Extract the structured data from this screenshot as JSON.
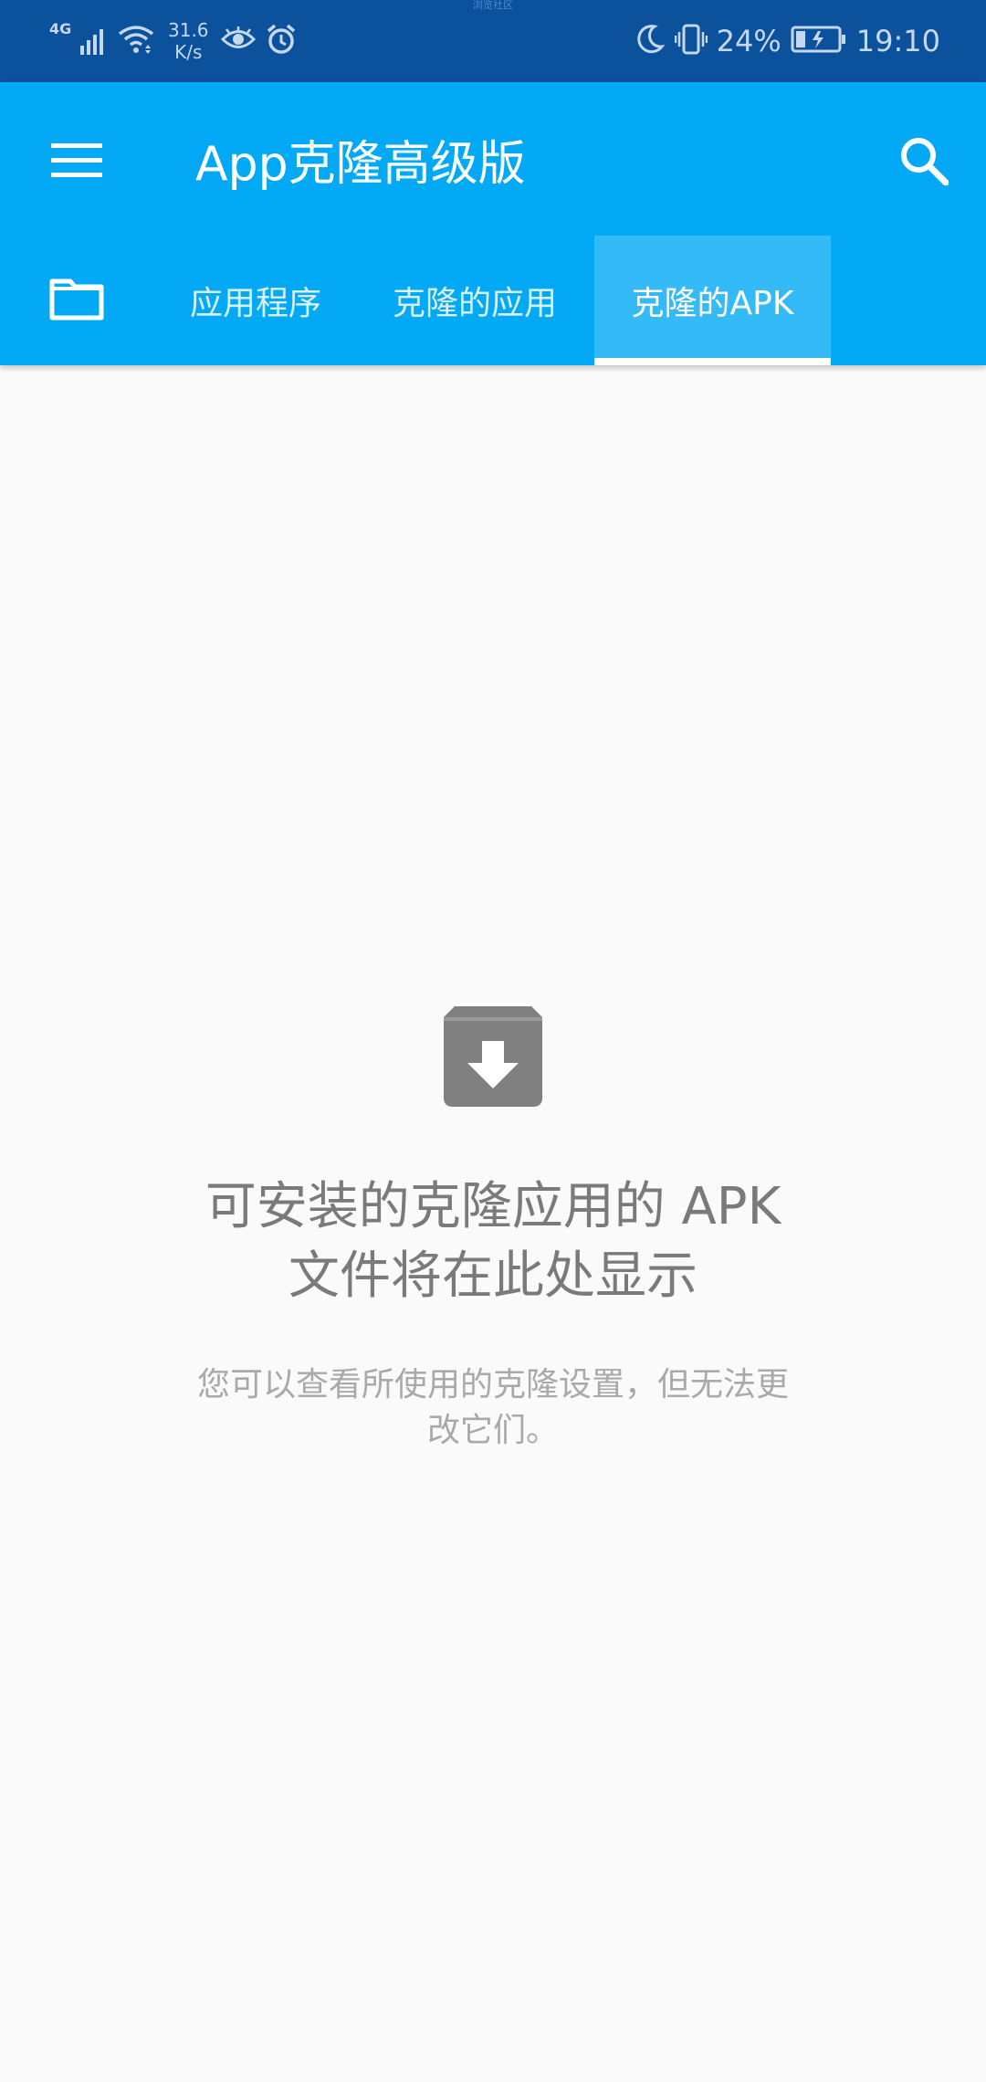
{
  "status_bar": {
    "notch_label": "浏览社区",
    "network_type": "4G",
    "net_speed_value": "31.6",
    "net_speed_unit": "K/s",
    "battery_percent": "24%",
    "time": "19:10",
    "icons_left": [
      "signal-icon",
      "wifi-icon",
      "eye-icon",
      "alarm-icon"
    ],
    "icons_right": [
      "moon-icon",
      "vibrate-icon",
      "battery-icon"
    ],
    "background_color": "#0c519c"
  },
  "app_bar": {
    "title": "App克隆高级版",
    "background_color": "#03a9f4",
    "tabs": [
      {
        "label": "应用程序",
        "selected": false
      },
      {
        "label": "克隆的应用",
        "selected": false
      },
      {
        "label": "克隆的APK",
        "selected": true
      }
    ]
  },
  "empty_state": {
    "icon": "archive-download-icon",
    "title_line1": "可安装的克隆应用的 APK",
    "title_line2": "文件将在此处显示",
    "description_line1": "您可以查看所使用的克隆设置，但无法更",
    "description_line2": "改它们。"
  }
}
